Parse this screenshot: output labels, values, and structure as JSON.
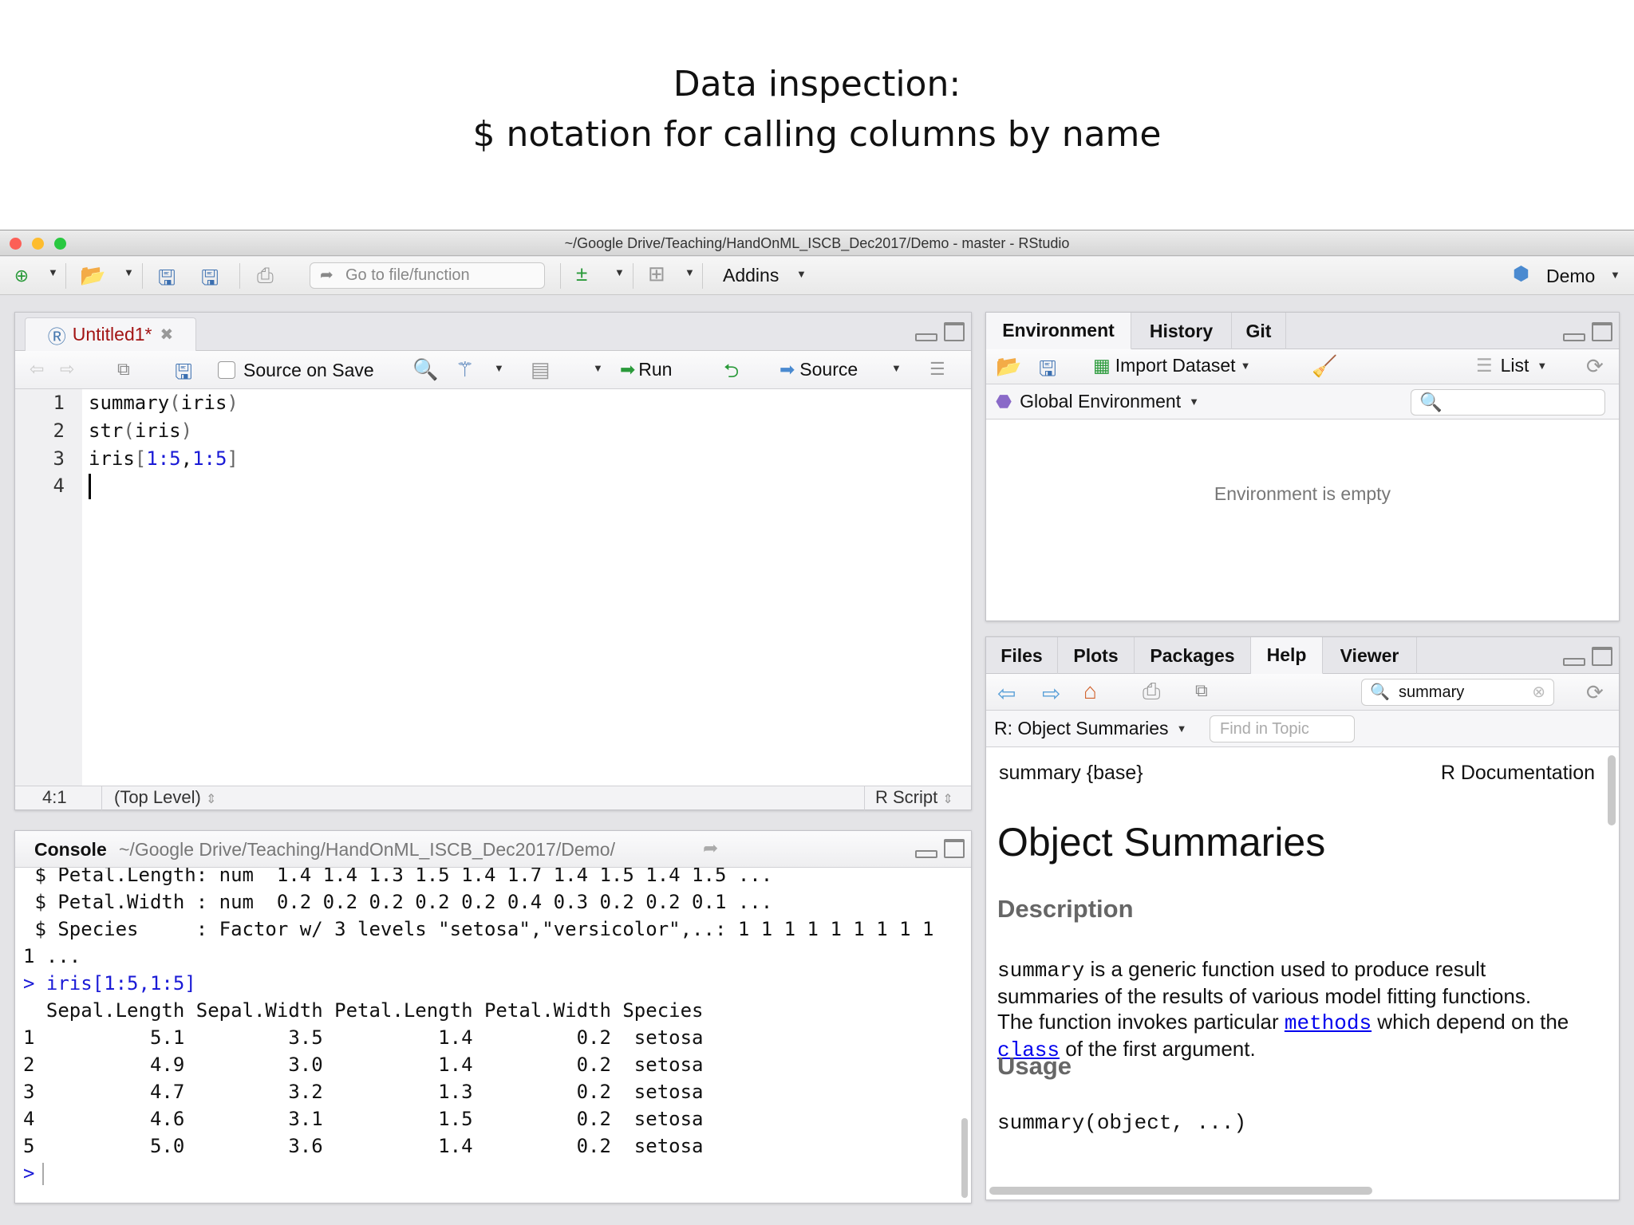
{
  "slide": {
    "title_line1": "Data inspection:",
    "title_line2": "$ notation for calling columns by name"
  },
  "window": {
    "title": "~/Google Drive/Teaching/HandOnML_ISCB_Dec2017/Demo - master - RStudio"
  },
  "toolbar": {
    "goto_placeholder": "Go to file/function",
    "addins": "Addins",
    "project": "Demo"
  },
  "source": {
    "tab_label": "Untitled1*",
    "source_on_save": "Source on Save",
    "run": "Run",
    "source": "Source",
    "lines": [
      "1",
      "2",
      "3",
      "4"
    ],
    "code": {
      "l1a": "summary",
      "l1b": "(",
      "l1c": "iris",
      "l1d": ")",
      "l2a": "str",
      "l2b": "(",
      "l2c": "iris",
      "l2d": ")",
      "l3a": "iris",
      "l3b": "[",
      "l3c": "1:5",
      ",": ",",
      "l3e": "1:5",
      "l3f": "]"
    },
    "status": {
      "position": "4:1",
      "scope": "(Top Level)",
      "filetype": "R Script"
    }
  },
  "console": {
    "label": "Console",
    "path": "~/Google Drive/Teaching/HandOnML_ISCB_Dec2017/Demo/",
    "lines": [
      " $ Petal.Length: num  1.4 1.4 1.3 1.5 1.4 1.7 1.4 1.5 1.4 1.5 ...",
      " $ Petal.Width : num  0.2 0.2 0.2 0.2 0.2 0.4 0.3 0.2 0.2 0.1 ...",
      " $ Species     : Factor w/ 3 levels \"setosa\",\"versicolor\",..: 1 1 1 1 1 1 1 1 1",
      "1 ..."
    ],
    "prompt": ">",
    "command": "iris[1:5,1:5]",
    "table_header": "  Sepal.Length Sepal.Width Petal.Length Petal.Width Species",
    "table_rows": [
      "1          5.1         3.5          1.4         0.2  setosa",
      "2          4.9         3.0          1.4         0.2  setosa",
      "3          4.7         3.2          1.3         0.2  setosa",
      "4          4.6         3.1          1.5         0.2  setosa",
      "5          5.0         3.6          1.4         0.2  setosa"
    ]
  },
  "env": {
    "tabs": [
      "Environment",
      "History",
      "Git"
    ],
    "import_dataset": "Import Dataset",
    "list": "List",
    "global_env": "Global Environment",
    "empty": "Environment is empty"
  },
  "help": {
    "tabs": [
      "Files",
      "Plots",
      "Packages",
      "Help",
      "Viewer"
    ],
    "search_value": "summary",
    "topic": "R: Object Summaries",
    "find_placeholder": "Find in Topic",
    "pkg": "summary {base}",
    "rdoc": "R Documentation",
    "title": "Object Summaries",
    "desc_heading": "Description",
    "desc_code": "summary",
    "desc_1": " is a generic function used to produce result summaries of the results of various model fitting functions. The function invokes particular ",
    "desc_link1": "methods",
    "desc_2": " which depend on the ",
    "desc_link2": "class",
    "desc_3": " of the first argument.",
    "usage_heading": "Usage",
    "usage_code": "summary(object, ...)"
  }
}
